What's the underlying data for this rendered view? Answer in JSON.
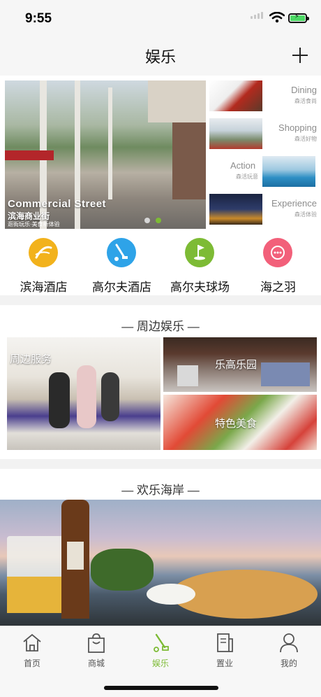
{
  "status": {
    "time": "9:55"
  },
  "nav": {
    "title": "娱乐",
    "add_icon": "plus-icon"
  },
  "banner": {
    "hero_title": "Commercial Street",
    "hero_subtitle": "滨海商业街",
    "hero_caption": "逛街玩乐·美食新体验",
    "carousel_total": 2,
    "carousel_active": 2,
    "side_items": [
      {
        "en": "Dining",
        "cn": "森活食尚"
      },
      {
        "en": "Shopping",
        "cn": "森活好物"
      },
      {
        "en": "Action",
        "cn": "森活玩意"
      },
      {
        "en": "Experience",
        "cn": "森活体验"
      }
    ]
  },
  "quick_links": [
    {
      "label": "滨海酒店",
      "icon": "hotel-icon",
      "color": "#f2b21c"
    },
    {
      "label": "高尔夫酒店",
      "icon": "golf-club-icon",
      "color": "#2ea3e8"
    },
    {
      "label": "高尔夫球场",
      "icon": "golf-course-icon",
      "color": "#7dbb35"
    },
    {
      "label": "海之羽",
      "icon": "sea-feather-icon",
      "color": "#f2607a"
    }
  ],
  "nearby": {
    "title": "— 周边娱乐 —",
    "tiles": [
      {
        "label": "周边服务"
      },
      {
        "label": "乐高乐园"
      },
      {
        "label": "特色美食"
      }
    ]
  },
  "coast": {
    "title": "— 欢乐海岸 —"
  },
  "tabs": [
    {
      "label": "首页",
      "icon": "home-icon",
      "active": false
    },
    {
      "label": "商城",
      "icon": "shopping-bag-icon",
      "active": false
    },
    {
      "label": "娱乐",
      "icon": "golf-club-icon",
      "active": true
    },
    {
      "label": "置业",
      "icon": "document-icon",
      "active": false
    },
    {
      "label": "我的",
      "icon": "person-icon",
      "active": false
    }
  ],
  "colors": {
    "accent": "#7dbb35"
  }
}
